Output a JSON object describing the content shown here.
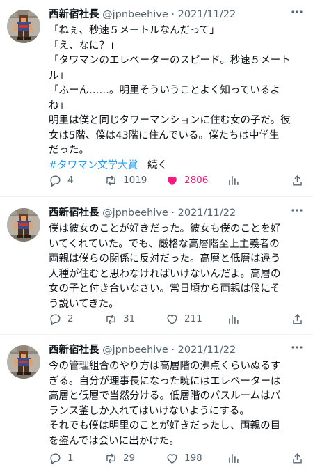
{
  "tweets": [
    {
      "author": "西新宿社長",
      "handle": "@jpnbeehive",
      "separator": "·",
      "date": "2021/11/22",
      "lines": [
        "「ねぇ、秒速５メートルなんだって」",
        "「え、なに？」",
        "「タワマンのエレベーターのスピード。秒速５メート",
        "ル」",
        "「ふーん……。明里そういうことよく知っているよ",
        "ね」",
        "明里は僕と同じタワーマンションに住む女の子だ。彼",
        "女は5階、僕は43階に住んでいる。僕たちは中学生",
        "だった。"
      ],
      "hashtag": "#タワマン文学大賞",
      "continued": "続く",
      "replies": "4",
      "retweets": "1019",
      "likes": "2806",
      "liked": true
    },
    {
      "author": "西新宿社長",
      "handle": "@jpnbeehive",
      "separator": "·",
      "date": "2021/11/22",
      "lines": [
        "僕は彼女のことが好きだった。彼女も僕のことを好",
        "いてくれていた。でも、厳格な高層階至上主義者の",
        "両親は僕らの関係に反対だった。高層と低層は違う",
        "人種が住むと思わなければいけないんだよ。高層の",
        "女の子と付き合いなさい。常日頃から両親は僕にそ",
        "う説いてきた。"
      ],
      "replies": "2",
      "retweets": "31",
      "likes": "211",
      "liked": false
    },
    {
      "author": "西新宿社長",
      "handle": "@jpnbeehive",
      "separator": "·",
      "date": "2021/11/22",
      "lines": [
        "今の管理組合のやり方は高層階の沸点くらいぬるす",
        "ぎる。自分が理事長になった暁にはエレベーターは",
        "高層と低層で当然分ける。低層階のバスルームはバ",
        "ランス釜しか入れてはいけないようにする。",
        "それでも僕は明里のことが好きだったし、両親の目",
        "を盗んでは会いに出かけた。"
      ],
      "replies": "1",
      "retweets": "29",
      "likes": "198",
      "liked": false
    }
  ],
  "icons": {
    "more": "more-dots-icon",
    "reply": "reply-bubble-icon",
    "retweet": "retweet-arrows-icon",
    "like": "heart-icon",
    "views": "analytics-bars-icon",
    "share": "share-upload-icon"
  },
  "colors": {
    "text": "#0f1419",
    "secondary": "#536471",
    "link": "#1d9bf0",
    "like": "#f91880",
    "divider": "#eff3f4"
  }
}
